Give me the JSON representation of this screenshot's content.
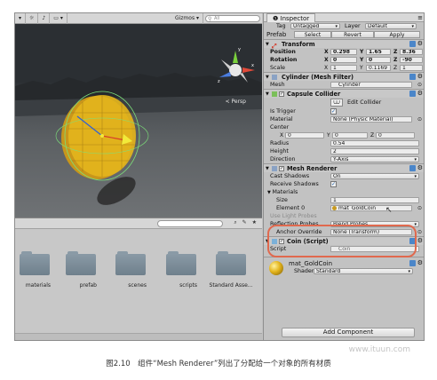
{
  "scene": {
    "toolbar": {
      "gizmos_label": "Gizmos ▾",
      "search_placeholder": "All"
    },
    "persp_label": "< Persp",
    "axes": {
      "x": "x",
      "y": "y",
      "z": "z"
    }
  },
  "project": {
    "folders": [
      {
        "label": "materials"
      },
      {
        "label": "prefab"
      },
      {
        "label": "scenes"
      },
      {
        "label": "scripts"
      },
      {
        "label": "Standard Asse..."
      }
    ]
  },
  "inspector": {
    "tab_label": "Inspector",
    "tag_label": "Tag",
    "tag_value": "Untagged",
    "layer_label": "Layer",
    "layer_value": "Default",
    "prefab_label": "Prefab",
    "select_label": "Select",
    "revert_label": "Revert",
    "apply_label": "Apply",
    "transform": {
      "title": "Transform",
      "position_label": "Position",
      "rotation_label": "Rotation",
      "scale_label": "Scale",
      "position": {
        "x": "0.298",
        "y": "1.65",
        "z": "8.36"
      },
      "rotation": {
        "x": "0",
        "y": "0",
        "z": "-90"
      },
      "scale": {
        "x": "1",
        "y": "0.1169",
        "z": "1"
      }
    },
    "mesh_filter": {
      "title": "Cylinder (Mesh Filter)",
      "mesh_label": "Mesh",
      "mesh_value": "Cylinder"
    },
    "capsule_collider": {
      "title": "Capsule Collider",
      "edit_label": "Edit Collider",
      "is_trigger_label": "Is Trigger",
      "material_label": "Material",
      "material_value": "None (Physic Material)",
      "center_label": "Center",
      "center": {
        "x": "0",
        "y": "0",
        "z": "0"
      },
      "radius_label": "Radius",
      "radius_value": "0.54",
      "height_label": "Height",
      "height_value": "2",
      "direction_label": "Direction",
      "direction_value": "Y-Axis"
    },
    "mesh_renderer": {
      "title": "Mesh Renderer",
      "cast_shadows_label": "Cast Shadows",
      "cast_shadows_value": "On",
      "receive_shadows_label": "Receive Shadows",
      "materials_label": "Materials",
      "size_label": "Size",
      "size_value": "1",
      "element0_label": "Element 0",
      "element0_value": "mat_GoldCoin",
      "use_light_probes_label": "Use Light Probes",
      "reflection_probes_label": "Reflection Probes",
      "reflection_probes_value": "Blend Probes",
      "anchor_override_label": "Anchor Override",
      "anchor_override_value": "None (Transform)"
    },
    "coin_script": {
      "title": "Coin (Script)",
      "script_label": "Script",
      "script_value": "Coin"
    },
    "material": {
      "name": "mat_GoldCoin",
      "shader_label": "Shader",
      "shader_value": "Standard"
    },
    "add_component_label": "Add Component"
  },
  "caption": "图2.10　组件“Mesh Renderer”列出了分配给一个对象的所有材质",
  "colors": {
    "highlight": "#e0694e",
    "coin_gold": "#e3b41c"
  }
}
